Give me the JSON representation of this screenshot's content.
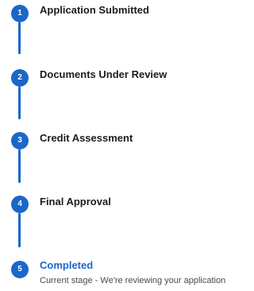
{
  "steps": [
    {
      "number": "1",
      "title": "Application Submitted"
    },
    {
      "number": "2",
      "title": "Documents Under Review"
    },
    {
      "number": "3",
      "title": "Credit Assessment"
    },
    {
      "number": "4",
      "title": "Final Approval"
    },
    {
      "number": "5",
      "title": "Completed",
      "description": "Current stage - We're reviewing your application"
    }
  ],
  "current_step": 5,
  "colors": {
    "accent": "#1b67c9",
    "title_text": "#1c1c1c",
    "description_text": "#4a4a4a"
  }
}
